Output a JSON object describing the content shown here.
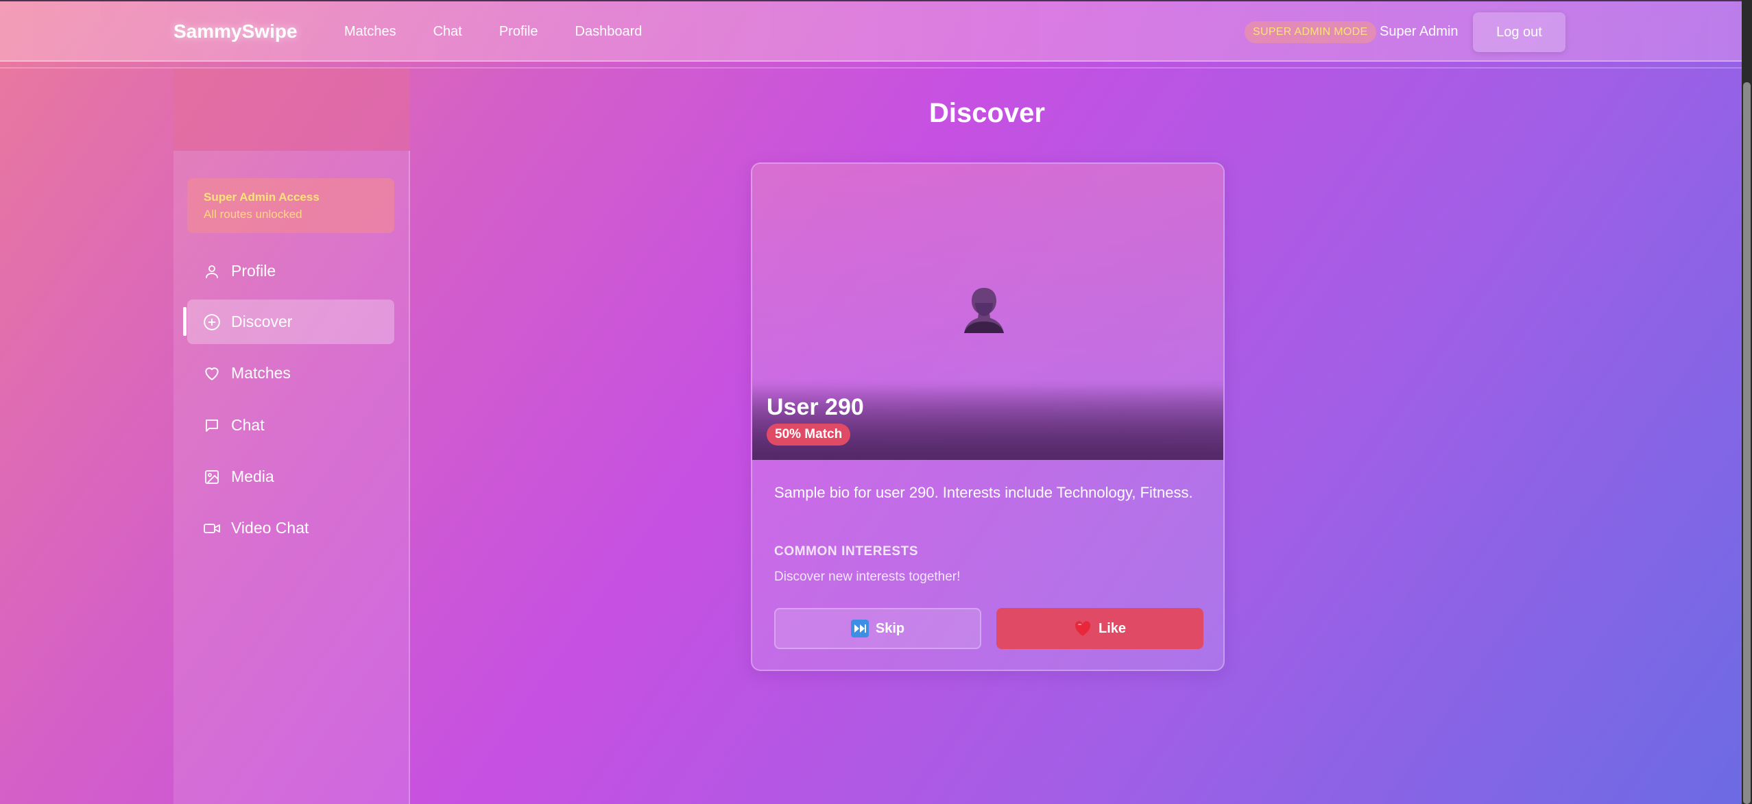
{
  "header": {
    "brand": "SammySwipe",
    "nav": [
      "Matches",
      "Chat",
      "Profile",
      "Dashboard"
    ],
    "admin_badge": "SUPER ADMIN MODE",
    "user_name": "Super Admin",
    "logout_label": "Log out"
  },
  "sidebar": {
    "access_title": "Super Admin Access",
    "access_subtitle": "All routes unlocked",
    "items": [
      {
        "label": "Profile",
        "icon": "user-icon"
      },
      {
        "label": "Discover",
        "icon": "compass-plus-icon",
        "active": true
      },
      {
        "label": "Matches",
        "icon": "heart-icon"
      },
      {
        "label": "Chat",
        "icon": "message-icon"
      },
      {
        "label": "Media",
        "icon": "image-icon"
      },
      {
        "label": "Video Chat",
        "icon": "video-icon"
      }
    ]
  },
  "main": {
    "title": "Discover",
    "card": {
      "user_name": "User 290",
      "match_badge": "50% Match",
      "bio": "Sample bio for user 290. Interests include Technology, Fitness.",
      "common_title": "COMMON INTERESTS",
      "common_text": "Discover new interests together!",
      "skip_label": "Skip",
      "like_label": "Like"
    }
  },
  "colors": {
    "accent_like": "#e04a64",
    "admin_text": "#ffe27a"
  }
}
